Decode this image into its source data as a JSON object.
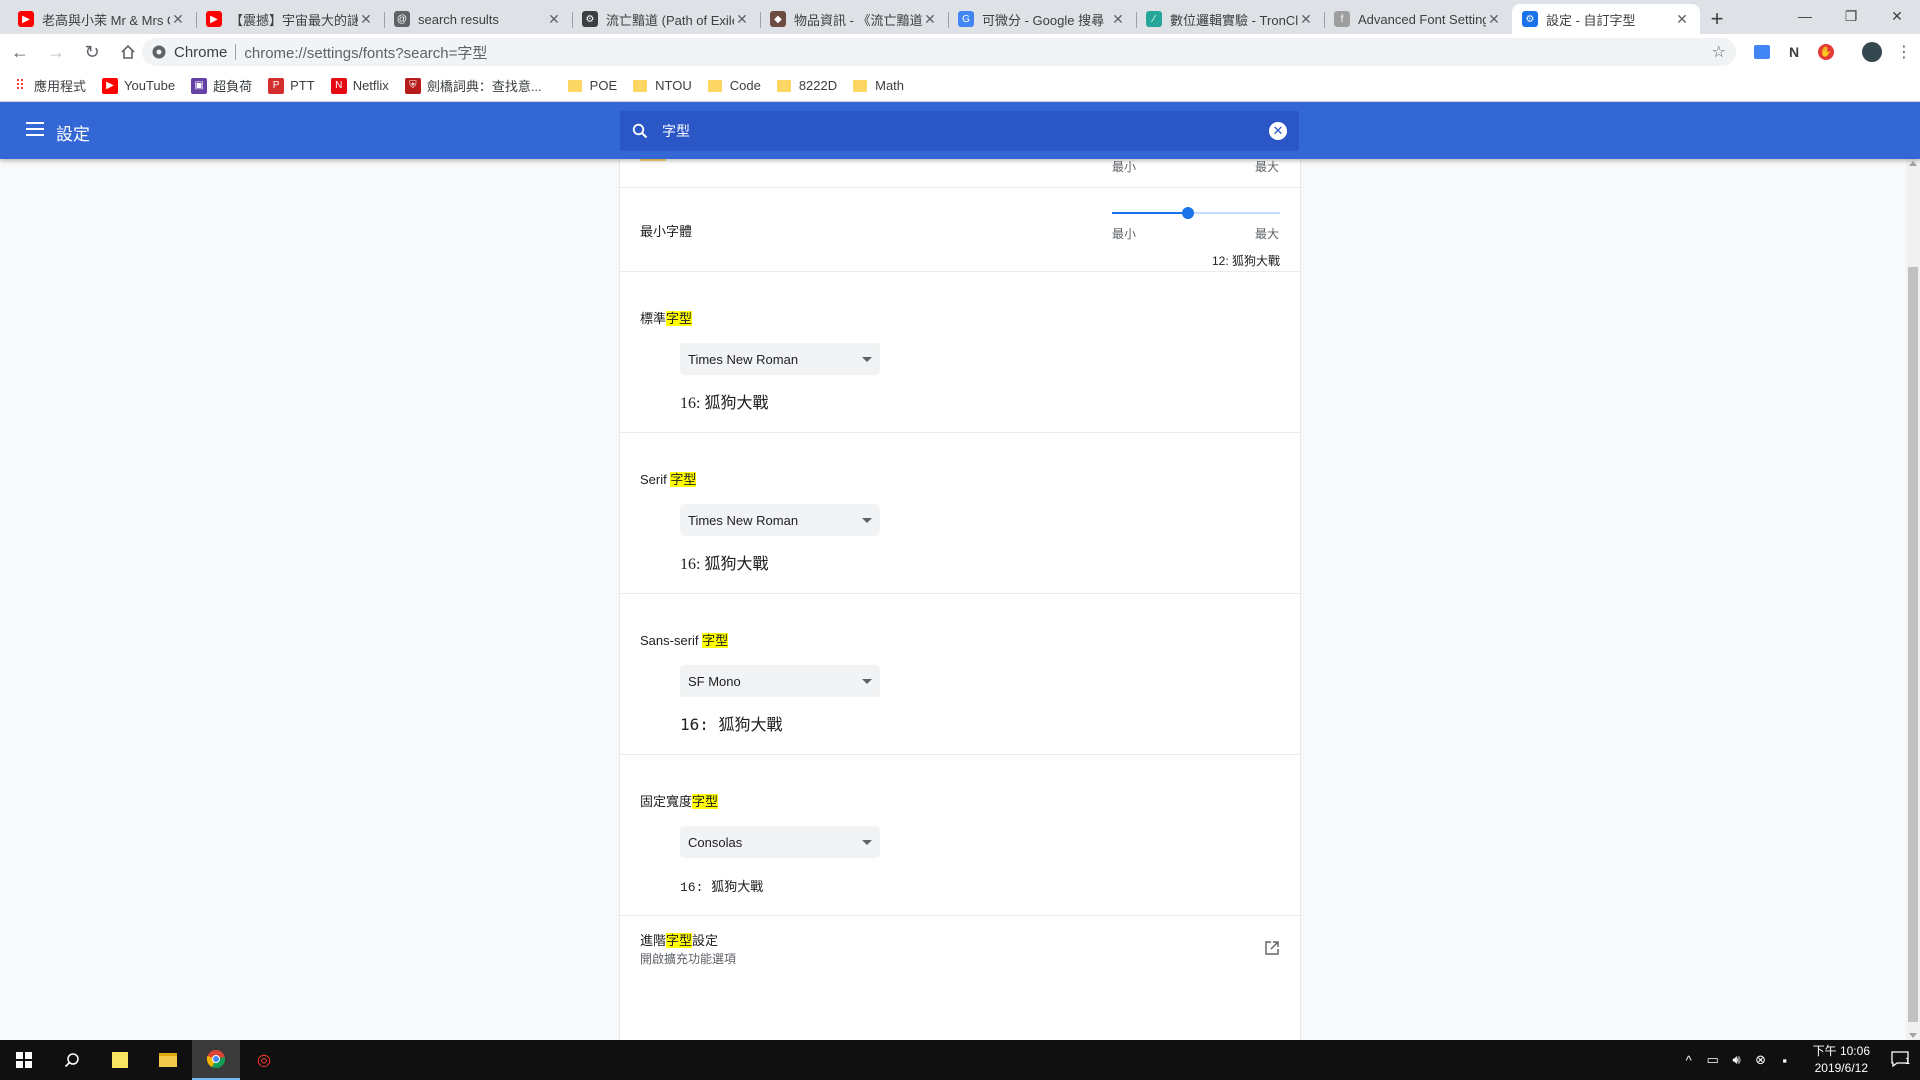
{
  "tabs": [
    {
      "title": "老高與小茉 Mr & Mrs Gao",
      "fav_color": "#ff0000",
      "fav_glyph": "▶"
    },
    {
      "title": "【震撼】宇宙最大的謎",
      "fav_color": "#ff0000",
      "fav_glyph": "▶"
    },
    {
      "title": "search results",
      "fav_color": "#5f6368",
      "fav_glyph": "@"
    },
    {
      "title": "流亡黯道 (Path of Exile)",
      "fav_color": "#3c4043",
      "fav_glyph": "⚙"
    },
    {
      "title": "物品資訊 - 《流亡黯道",
      "fav_color": "#6d4c41",
      "fav_glyph": "◆"
    },
    {
      "title": "可微分 - Google 搜尋",
      "fav_color": "#4285f4",
      "fav_glyph": "G"
    },
    {
      "title": "數位邏輯實驗 - TronClass",
      "fav_color": "#26a69a",
      "fav_glyph": "∕"
    },
    {
      "title": "Advanced Font Settings",
      "fav_color": "#9e9e9e",
      "fav_glyph": "f"
    },
    {
      "title": "設定 - 自訂字型",
      "fav_color": "#1a73e8",
      "fav_glyph": "⚙",
      "active": true
    }
  ],
  "new_tab": "+",
  "window_controls": {
    "minimize": "—",
    "maximize": "❐",
    "close": "✕"
  },
  "omnibox": {
    "chip": "Chrome",
    "url": "chrome://settings/fonts?search=字型"
  },
  "bookmarks": [
    {
      "label": "應用程式",
      "type": "apps"
    },
    {
      "label": "YouTube",
      "type": "site",
      "color": "#ff0000",
      "glyph": "▶"
    },
    {
      "label": "超負荷",
      "type": "site",
      "color": "#6441a5",
      "glyph": "▣"
    },
    {
      "label": "PTT",
      "type": "site",
      "color": "#d32f2f",
      "glyph": "P"
    },
    {
      "label": "Netflix",
      "type": "site",
      "color": "#e50914",
      "glyph": "N"
    },
    {
      "label": "劍橋詞典：查找意...",
      "type": "site",
      "color": "#b71c1c",
      "glyph": "⛨"
    },
    {
      "label": "POE",
      "type": "folder"
    },
    {
      "label": "NTOU",
      "type": "folder"
    },
    {
      "label": "Code",
      "type": "folder"
    },
    {
      "label": "8222D",
      "type": "folder"
    },
    {
      "label": "Math",
      "type": "folder"
    }
  ],
  "header": {
    "title": "設定",
    "search_value": "字型"
  },
  "font_size": {
    "min_label": "最小",
    "max_label": "最大"
  },
  "minimum_font": {
    "label": "最小字體",
    "min_label": "最小",
    "max_label": "最大",
    "value_fraction": 0.45,
    "preview": "12: 狐狗大戰"
  },
  "standard_font": {
    "label_pre": "標準",
    "label_hl": "字型",
    "label_post": "",
    "selected": "Times New Roman",
    "preview": "16: 狐狗大戰"
  },
  "serif_font": {
    "label_pre": "Serif ",
    "label_hl": "字型",
    "label_post": "",
    "selected": "Times New Roman",
    "preview": "16: 狐狗大戰"
  },
  "sans_font": {
    "label_pre": "Sans-serif ",
    "label_hl": "字型",
    "label_post": "",
    "selected": "SF Mono",
    "preview": "16: 狐狗大戰"
  },
  "fixed_font": {
    "label_pre": "固定寬度",
    "label_hl": "字型",
    "label_post": "",
    "selected": "Consolas",
    "preview": "16: 狐狗大戰"
  },
  "advanced": {
    "label_pre": "進階",
    "label_hl": "字型",
    "label_post": "設定",
    "sublabel": "開啟擴充功能選項"
  },
  "taskbar": {
    "time": "下午 10:06",
    "date": "2019/6/12",
    "notifications": "1"
  }
}
